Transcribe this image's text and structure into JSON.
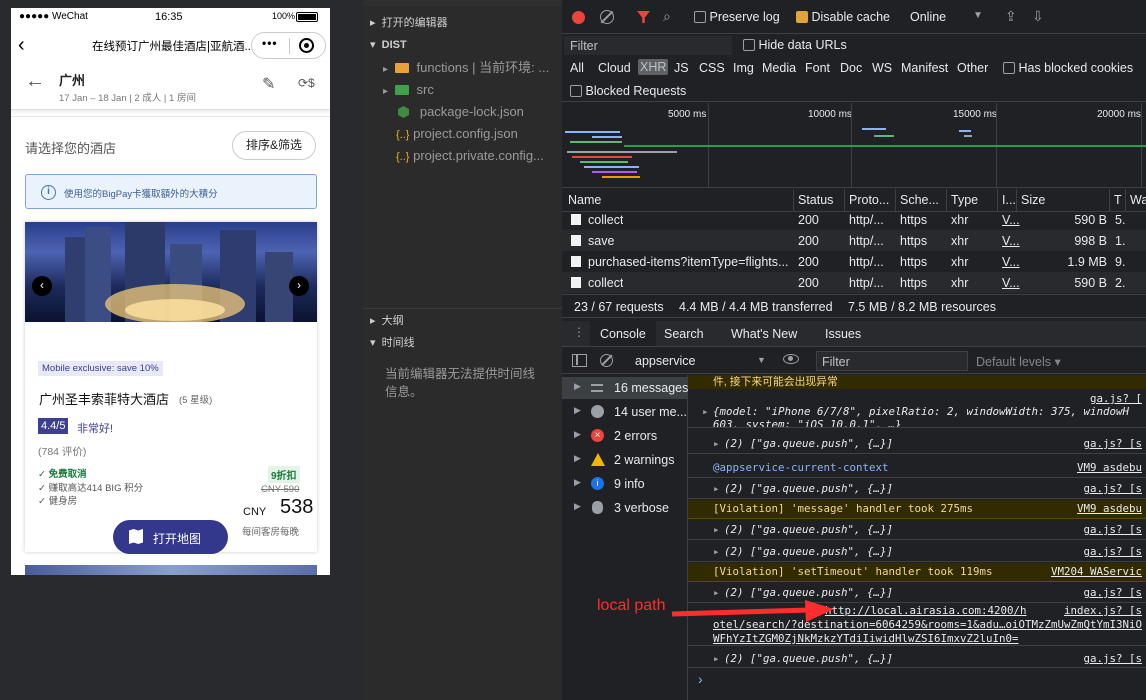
{
  "phone": {
    "status": {
      "carrier": "●●●●● WeChat",
      "time": "16:35",
      "battery": "100%"
    },
    "nav_title": "在线预订广州最佳酒店|亚航酒...",
    "header": {
      "city": "广州",
      "dates": "17 Jan – 18 Jan | 2 成人 | 1 房间"
    },
    "select_title": "请选择您的酒店",
    "sort_button": "排序&筛选",
    "bigpay_note": "使用您的BigPay卡獲取額外的大積分",
    "badge": "Mobile exclusive: save 10%",
    "hotel_name": "广州圣丰索菲特大酒店",
    "stars": "(5 星级)",
    "rating": "4.4/5",
    "rating_text": "非常好!",
    "reviews": "(784 评价)",
    "perks": [
      "免费取消",
      "赚取高达414 BIG 积分",
      "健身房"
    ],
    "discount": "9折扣",
    "old_price": "CNY 590",
    "currency": "CNY",
    "price": "538",
    "price_note": "每间客房每晚",
    "map_button": "打开地图"
  },
  "ide": {
    "top_section": "打开的编辑器",
    "dist_section": "DIST",
    "files": [
      "functions | 当前环境: ...",
      "src",
      "package-lock.json",
      "project.config.json",
      "project.private.config..."
    ],
    "outline": "大纲",
    "timeline": "时间线",
    "timeline_msg": "当前编辑器无法提供时间线信息。"
  },
  "network": {
    "preserve_log": "Preserve log",
    "disable_cache": "Disable cache",
    "throttle": "Online",
    "filter_placeholder": "Filter",
    "hide_data_urls": "Hide data URLs",
    "types": [
      "All",
      "Cloud",
      "XHR",
      "JS",
      "CSS",
      "Img",
      "Media",
      "Font",
      "Doc",
      "WS",
      "Manifest",
      "Other"
    ],
    "has_blocked": "Has blocked cookies",
    "blocked_requests": "Blocked Requests",
    "timeline_ticks": [
      "5000 ms",
      "10000 ms",
      "15000 ms",
      "20000 ms"
    ],
    "columns": [
      "Name",
      "Status",
      "Proto...",
      "Sche...",
      "Type",
      "I...",
      "Size",
      "T",
      "Wa"
    ],
    "rows": [
      {
        "name": "collect",
        "status": "200",
        "proto": "http/...",
        "scheme": "https",
        "type": "xhr",
        "init": "V...",
        "size": "590 B",
        "t": "5."
      },
      {
        "name": "save",
        "status": "200",
        "proto": "http/...",
        "scheme": "https",
        "type": "xhr",
        "init": "V...",
        "size": "998 B",
        "t": "1."
      },
      {
        "name": "purchased-items?itemType=flights...",
        "status": "200",
        "proto": "http/...",
        "scheme": "https",
        "type": "xhr",
        "init": "V...",
        "size": "1.9 MB",
        "t": "9."
      },
      {
        "name": "collect",
        "status": "200",
        "proto": "http/...",
        "scheme": "https",
        "type": "xhr",
        "init": "V...",
        "size": "590 B",
        "t": "2."
      }
    ],
    "summary": {
      "requests": "23 / 67 requests",
      "transferred": "4.4 MB / 4.4 MB transferred",
      "resources": "7.5 MB / 8.2 MB resources"
    }
  },
  "drawer": {
    "tabs": [
      "Console",
      "Search",
      "What's New",
      "Issues"
    ]
  },
  "console": {
    "context": "appservice",
    "filter_placeholder": "Filter",
    "levels": "Default levels ▾",
    "sidebar": [
      {
        "count": "16 messages",
        "icon": "list-icon"
      },
      {
        "count": "14 user me...",
        "icon": "user-icon"
      },
      {
        "count": "2 errors",
        "icon": "error-icon"
      },
      {
        "count": "2 warnings",
        "icon": "warning-icon"
      },
      {
        "count": "9 info",
        "icon": "info-icon"
      },
      {
        "count": "3 verbose",
        "icon": "bug-icon"
      }
    ],
    "lines": {
      "l1": "件, 接下来可能会出现异常",
      "l2_src": "ga.js? [",
      "l2_a": "{model: \"iPhone 6/7/8\", pixelRatio: 2, windowWidth: 375, windowH",
      "l2_b": "603, system: \"iOS 10.0.1\", …}",
      "push": "(2) [\"ga.queue.push\", {…}]",
      "ga_src": "ga.js? [s",
      "context_line": "@appservice-current-context",
      "vm9": "VM9 asdebu",
      "violation_msg": "[Violation] 'message' handler took 275ms",
      "violation_timeout": "[Violation] 'setTimeout' handler took 119ms",
      "vm204": "VM204 WAServic",
      "url_a": "http://local.airasia.com:4200/h",
      "url_prefix": "...",
      "index_src": "index.js? [s",
      "url_b": "otel/search/?destination=6064259&rooms=1&adu…oiOTMzZmUwZmQtYmI3NiO",
      "url_c": "WFhYzItZGM0ZjNkMzkzYTdiIiwidHlwZSI6ImxvZ2luIn0="
    },
    "prompt": "›"
  },
  "annotation": {
    "label": "local path",
    "color": "#ff2d2d"
  }
}
